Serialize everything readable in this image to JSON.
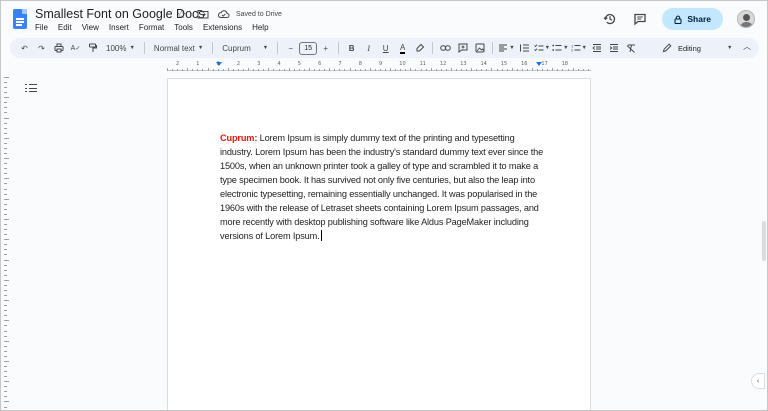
{
  "titlebar": {
    "doc_title": "Smallest Font on Google Docs",
    "saved_status": "Saved to Drive",
    "share_label": "Share"
  },
  "menu": [
    "File",
    "Edit",
    "View",
    "Insert",
    "Format",
    "Tools",
    "Extensions",
    "Help"
  ],
  "toolbar": {
    "zoom": "100%",
    "style": "Normal text",
    "font": "Cuprum",
    "font_size": "15",
    "mode": "Editing"
  },
  "ruler": {
    "numbers": [
      "2",
      "1",
      "1",
      "2",
      "3",
      "4",
      "5",
      "6",
      "7",
      "8",
      "9",
      "10",
      "11",
      "12",
      "13",
      "14",
      "15",
      "16",
      "17",
      "18"
    ]
  },
  "document": {
    "label": "Cuprum:",
    "text": " Lorem Ipsum is simply dummy text of the printing and typesetting industry. Lorem Ipsum has been the industry's standard dummy text ever since the 1500s, when an unknown printer took a galley of type and scrambled it to make a type specimen book. It has survived not only five centuries, but also the leap into electronic typesetting, remaining essentially unchanged. It was popularised in the 1960s with the release of Letraset sheets containing Lorem Ipsum passages, and more recently with desktop publishing software like Aldus PageMaker including versions of Lorem Ipsum."
  },
  "colors": {
    "label_red": "#e8170b",
    "share_bg": "#c2e7ff",
    "toolbar_bg": "#edf2fa",
    "docs_blue": "#3b82f6"
  },
  "icons": {
    "doc_logo": "docs-logo-icon",
    "star": "star-icon",
    "move": "folder-move-icon",
    "cloud": "cloud-saved-icon",
    "history": "history-icon",
    "comments": "comment-icon",
    "lock": "lock-icon",
    "outline": "document-outline-icon"
  }
}
